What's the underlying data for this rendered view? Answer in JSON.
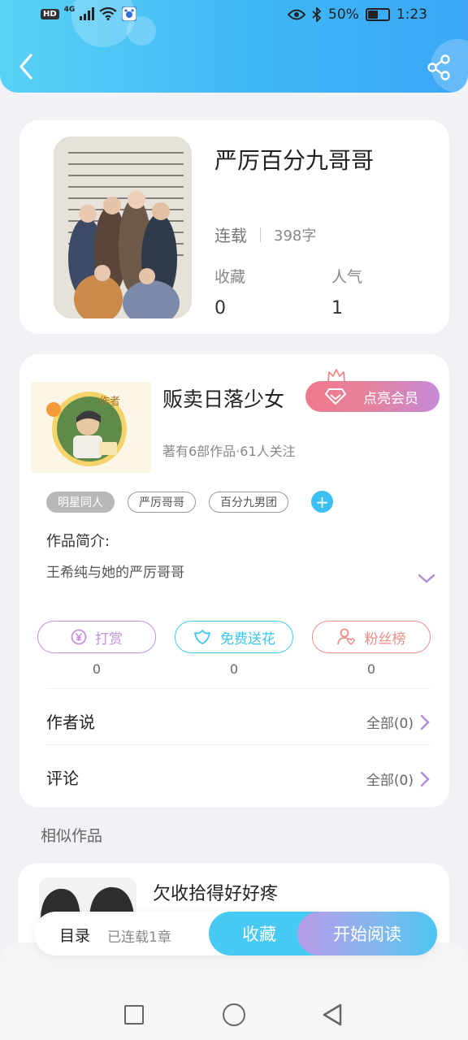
{
  "status_bar": {
    "network": "HD",
    "signal": "4G",
    "battery_percent": "50%",
    "time": "1:23",
    "battery_level": 0.5
  },
  "header": {
    "back_icon": "chevron-left-icon",
    "share_icon": "share-icon"
  },
  "book": {
    "title": "严厉百分九哥哥",
    "status": "连载",
    "word_count": "398字",
    "favorites_label": "收藏",
    "favorites_value": "0",
    "popularity_label": "人气",
    "popularity_value": "1"
  },
  "author": {
    "name": "贩卖日落少女",
    "avatar_badge": "作者",
    "vip_label": "点亮会员",
    "meta": "著有6部作品·61人关注",
    "tags": [
      "明星同人",
      "严厉哥哥",
      "百分九男团"
    ],
    "add_tag": "+",
    "intro_label": "作品简介:",
    "intro_text": "王希纯与她的严厉哥哥"
  },
  "actions": [
    {
      "label": "打赏",
      "count": "0",
      "icon": "yen-coin-icon",
      "color": "#c78ee0"
    },
    {
      "label": "免费送花",
      "count": "0",
      "icon": "flower-icon",
      "color": "#3cc6ef"
    },
    {
      "label": "粉丝榜",
      "count": "0",
      "icon": "user-heart-icon",
      "color": "#ee8e86"
    }
  ],
  "author_says": {
    "label": "作者说",
    "link": "全部(0)"
  },
  "comments": {
    "label": "评论",
    "link": "全部(0)"
  },
  "similar": {
    "title": "相似作品",
    "items": [
      {
        "name": "欠收拾得好好疼"
      }
    ]
  },
  "reading_bar": {
    "toc": "目录",
    "chapters": "已连载1章",
    "collect": "收藏",
    "start_reading": "开始阅读"
  },
  "colors": {
    "header_start": "#5ad1f5",
    "header_end": "#3aa6f5",
    "accent_blue": "#46c9f3",
    "accent_purple": "#c58ad8"
  }
}
